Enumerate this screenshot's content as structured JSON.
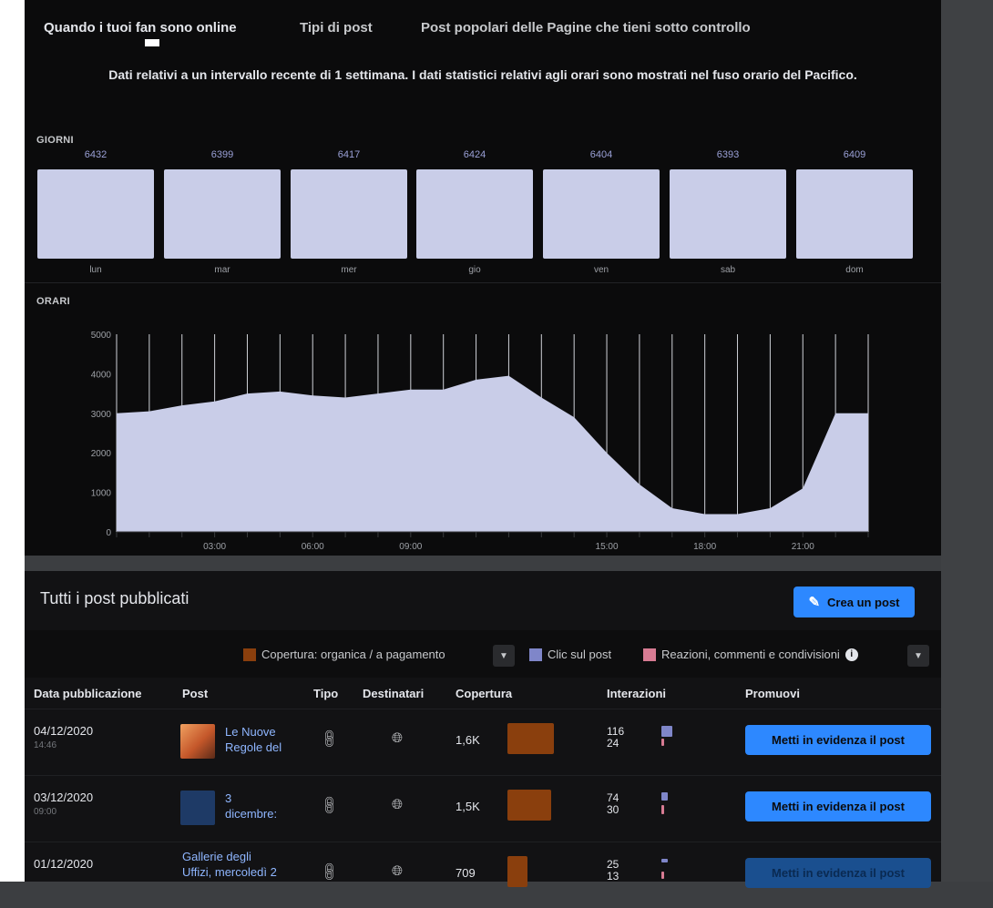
{
  "tabs": [
    {
      "label": "Quando i tuoi fan sono online"
    },
    {
      "label": "Tipi di post"
    },
    {
      "label": "Post popolari delle Pagine che tieni sotto controllo"
    }
  ],
  "notice": "Dati relativi a un intervallo recente di 1 settimana. I dati statistici relativi agli orari sono mostrati nel fuso orario del Pacifico.",
  "days_section": {
    "label": "GIORNI",
    "days": [
      {
        "name": "lun",
        "value": "6432"
      },
      {
        "name": "mar",
        "value": "6399"
      },
      {
        "name": "mer",
        "value": "6417"
      },
      {
        "name": "gio",
        "value": "6424"
      },
      {
        "name": "ven",
        "value": "6404"
      },
      {
        "name": "sab",
        "value": "6393"
      },
      {
        "name": "dom",
        "value": "6409"
      }
    ]
  },
  "hours_section": {
    "label": "ORARI"
  },
  "chart_data": {
    "type": "area",
    "x": [
      0,
      1,
      2,
      3,
      4,
      5,
      6,
      7,
      8,
      9,
      10,
      11,
      12,
      13,
      14,
      15,
      16,
      17,
      18,
      19,
      20,
      21,
      22,
      23
    ],
    "series": [
      {
        "values": [
          3000,
          3050,
          3200,
          3300,
          3500,
          3550,
          3450,
          3400,
          3500,
          3600,
          3600,
          3850,
          3950,
          3400,
          2900,
          2000,
          1200,
          600,
          450,
          450,
          600,
          1100,
          3000,
          3000
        ]
      }
    ],
    "xtick_labels": [
      "03:00",
      "06:00",
      "09:00",
      "15:00",
      "18:00",
      "21:00"
    ],
    "xtick_values": [
      3,
      6,
      9,
      15,
      18,
      21
    ],
    "yticks": [
      0,
      1000,
      2000,
      3000,
      4000,
      5000
    ],
    "ylim": [
      0,
      5000
    ],
    "fill_color": "#c9cde8"
  },
  "posts": {
    "title": "Tutti i post pubblicati",
    "create_label": "Crea un post",
    "legend": {
      "coverage": "Copertura: organica / a pagamento",
      "clicks": "Clic sul post",
      "reactions": "Reazioni, commenti e condivisioni"
    },
    "columns": [
      "Data pubblicazione",
      "Post",
      "Tipo",
      "Destinatari",
      "Copertura",
      "Interazioni",
      "Promuovi"
    ],
    "rows": [
      {
        "date": "04/12/2020",
        "time": "14:46",
        "post_lines": [
          "Le Nuove",
          "Regole del"
        ],
        "coverage": "1,6K",
        "coverage_frac": 1.0,
        "interactions": [
          "116",
          "24"
        ],
        "promote": "Metti in evidenza il post"
      },
      {
        "date": "03/12/2020",
        "time": "09:00",
        "post_lines": [
          "3",
          "dicembre:"
        ],
        "coverage": "1,5K",
        "coverage_frac": 0.94,
        "interactions": [
          "74",
          "30"
        ],
        "promote": "Metti in evidenza il post"
      },
      {
        "date": "01/12/2020",
        "time": "",
        "post_lines": [
          "Gallerie degli",
          "Uffizi, mercoledì 2"
        ],
        "coverage": "709",
        "coverage_frac": 0.44,
        "interactions": [
          "25",
          "13"
        ],
        "promote": "Metti in evidenza il post"
      }
    ]
  },
  "colors": {
    "accent": "#2d88ff",
    "coverage": "#8a3f0d",
    "clicks": "#7f86c9",
    "reactions": "#d77b93"
  }
}
